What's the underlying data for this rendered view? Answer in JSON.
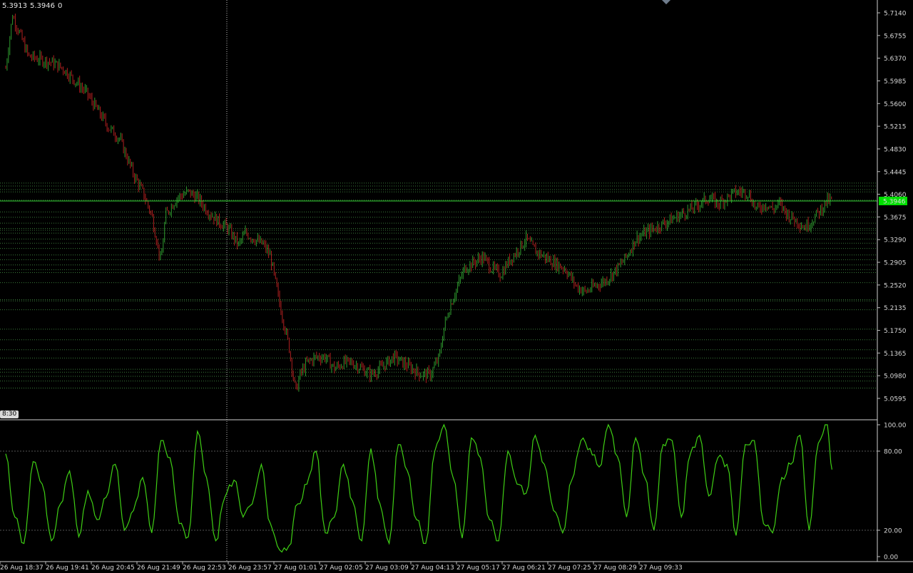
{
  "header": {
    "bid": "5.3913",
    "ask": "5.3946",
    "spread": "0"
  },
  "crosshair_time_label": "8:30",
  "colors": {
    "background": "#000000",
    "bull": "#2e9a2e",
    "bear": "#b02020",
    "level": "#3a7a3a",
    "price_line": "#34d034",
    "price_tag": "#00e000",
    "oscillator": "#3fcf14",
    "axis_text": "#d8d8d8"
  },
  "chart_data": [
    {
      "type": "candlestick",
      "title": "",
      "y_ticks": [
        "5.7140",
        "5.6755",
        "5.6370",
        "5.5985",
        "5.5600",
        "5.5215",
        "5.4830",
        "5.4445",
        "5.4060",
        "5.3675",
        "5.3290",
        "5.2905",
        "5.2520",
        "5.2135",
        "5.1750",
        "5.1365",
        "5.0980",
        "5.0595"
      ],
      "ylim": [
        5.04,
        5.724
      ],
      "current_price": "5.3946",
      "x_ticks": [
        "26 Aug 18:37",
        "26 Aug 19:41",
        "26 Aug 20:45",
        "26 Aug 21:49",
        "26 Aug 22:53",
        "26 Aug 23:57",
        "27 Aug 01:01",
        "27 Aug 02:05",
        "27 Aug 03:09",
        "27 Aug 04:13",
        "27 Aug 05:17",
        "27 Aug 06:21",
        "27 Aug 07:25",
        "27 Aug 08:29",
        "27 Aug 09:33"
      ],
      "horizontal_levels": [
        5.425,
        5.42,
        5.414,
        5.41,
        5.396,
        5.376,
        5.367,
        5.357,
        5.348,
        5.345,
        5.34,
        5.33,
        5.323,
        5.314,
        5.303,
        5.295,
        5.286,
        5.278,
        5.273,
        5.256,
        5.227,
        5.225,
        5.21,
        5.177,
        5.159,
        5.142,
        5.128,
        5.109,
        5.104,
        5.097,
        5.089,
        5.077
      ],
      "path_anchors": [
        [
          0.0,
          5.62
        ],
        [
          0.3,
          5.71
        ],
        [
          1.0,
          5.64
        ],
        [
          2.0,
          5.63
        ],
        [
          2.5,
          5.62
        ],
        [
          3.0,
          5.6
        ],
        [
          3.5,
          5.58
        ],
        [
          4.0,
          5.55
        ],
        [
          4.5,
          5.52
        ],
        [
          5.0,
          5.5
        ],
        [
          5.6,
          5.44
        ],
        [
          6.0,
          5.41
        ],
        [
          6.4,
          5.37
        ],
        [
          6.8,
          5.29
        ],
        [
          7.0,
          5.37
        ],
        [
          7.5,
          5.4
        ],
        [
          8.0,
          5.41
        ],
        [
          8.4,
          5.4
        ],
        [
          8.8,
          5.38
        ],
        [
          9.3,
          5.36
        ],
        [
          9.7,
          5.35
        ],
        [
          10.2,
          5.32
        ],
        [
          10.5,
          5.34
        ],
        [
          10.9,
          5.33
        ],
        [
          11.3,
          5.32
        ],
        [
          11.6,
          5.3
        ],
        [
          12.0,
          5.22
        ],
        [
          12.4,
          5.15
        ],
        [
          12.7,
          5.07
        ],
        [
          12.9,
          5.1
        ],
        [
          13.2,
          5.12
        ],
        [
          13.6,
          5.13
        ],
        [
          14.0,
          5.13
        ],
        [
          14.4,
          5.11
        ],
        [
          14.8,
          5.12
        ],
        [
          15.2,
          5.12
        ],
        [
          15.6,
          5.11
        ],
        [
          16.0,
          5.1
        ],
        [
          16.4,
          5.11
        ],
        [
          16.7,
          5.12
        ],
        [
          17.0,
          5.13
        ],
        [
          17.4,
          5.12
        ],
        [
          17.8,
          5.11
        ],
        [
          18.2,
          5.1
        ],
        [
          18.6,
          5.1
        ],
        [
          19.0,
          5.13
        ],
        [
          19.2,
          5.18
        ],
        [
          19.5,
          5.22
        ],
        [
          19.8,
          5.25
        ],
        [
          20.1,
          5.28
        ],
        [
          20.5,
          5.29
        ],
        [
          20.9,
          5.3
        ],
        [
          21.3,
          5.28
        ],
        [
          21.7,
          5.27
        ],
        [
          22.0,
          5.29
        ],
        [
          22.4,
          5.31
        ],
        [
          22.8,
          5.33
        ],
        [
          23.2,
          5.31
        ],
        [
          23.6,
          5.3
        ],
        [
          24.0,
          5.29
        ],
        [
          24.5,
          5.28
        ],
        [
          25.0,
          5.25
        ],
        [
          25.4,
          5.24
        ],
        [
          25.8,
          5.25
        ],
        [
          26.3,
          5.26
        ],
        [
          26.8,
          5.28
        ],
        [
          27.2,
          5.3
        ],
        [
          27.6,
          5.33
        ],
        [
          28.0,
          5.34
        ],
        [
          28.5,
          5.35
        ],
        [
          29.0,
          5.36
        ],
        [
          29.5,
          5.37
        ],
        [
          30.0,
          5.38
        ],
        [
          30.4,
          5.39
        ],
        [
          30.8,
          5.4
        ],
        [
          31.2,
          5.39
        ],
        [
          31.6,
          5.4
        ],
        [
          32.0,
          5.41
        ],
        [
          32.5,
          5.41
        ],
        [
          32.9,
          5.38
        ],
        [
          33.3,
          5.39
        ],
        [
          33.6,
          5.38
        ],
        [
          33.9,
          5.39
        ],
        [
          34.3,
          5.37
        ],
        [
          34.7,
          5.36
        ],
        [
          35.0,
          5.35
        ],
        [
          35.3,
          5.36
        ],
        [
          35.7,
          5.38
        ],
        [
          36.0,
          5.395
        ],
        [
          36.2,
          5.3946
        ]
      ]
    },
    {
      "type": "line",
      "title": "",
      "name": "",
      "y_ticks": [
        "100.00",
        "80.00",
        "20.00",
        "0.00"
      ],
      "ylim": [
        0,
        100
      ],
      "levels": [
        80,
        20
      ],
      "x": [
        0,
        0.4,
        0.8,
        1.2,
        1.6,
        2.0,
        2.4,
        2.8,
        3.2,
        3.6,
        4.0,
        4.4,
        4.8,
        5.2,
        5.6,
        6.0,
        6.4,
        6.8,
        7.2,
        7.6,
        8.0,
        8.4,
        8.8,
        9.2,
        9.6,
        10.0,
        10.4,
        10.8,
        11.2,
        11.6,
        12.0,
        12.4,
        12.8,
        13.2,
        13.6,
        14.0,
        14.4,
        14.8,
        15.2,
        15.6,
        16.0,
        16.4,
        16.8,
        17.2,
        17.6,
        18.0,
        18.4,
        18.8,
        19.2,
        19.6,
        20.0,
        20.4,
        20.8,
        21.2,
        21.6,
        22.0,
        22.4,
        22.8,
        23.2,
        23.6,
        24.0,
        24.4,
        24.8,
        25.2,
        25.6,
        26.0,
        26.4,
        26.8,
        27.2,
        27.6,
        28.0,
        28.4,
        28.8,
        29.2,
        29.6,
        30.0,
        30.4,
        30.8,
        31.2,
        31.6,
        32.0,
        32.4,
        32.8,
        33.2,
        33.6,
        34.0,
        34.4,
        34.8,
        35.2,
        35.6,
        36.0,
        36.2
      ],
      "values": [
        78,
        30,
        10,
        72,
        55,
        12,
        40,
        65,
        15,
        50,
        28,
        45,
        70,
        20,
        35,
        60,
        18,
        88,
        75,
        25,
        15,
        95,
        60,
        12,
        45,
        58,
        30,
        40,
        70,
        25,
        5,
        8,
        40,
        55,
        80,
        18,
        30,
        70,
        42,
        12,
        82,
        40,
        10,
        85,
        65,
        28,
        10,
        80,
        100,
        60,
        14,
        90,
        75,
        28,
        12,
        80,
        55,
        48,
        92,
        70,
        35,
        18,
        58,
        88,
        82,
        68,
        100,
        76,
        30,
        90,
        60,
        20,
        85,
        88,
        30,
        78,
        92,
        46,
        75,
        70,
        16,
        85,
        88,
        25,
        18,
        60,
        70,
        92,
        20,
        86,
        100,
        66
      ]
    }
  ]
}
